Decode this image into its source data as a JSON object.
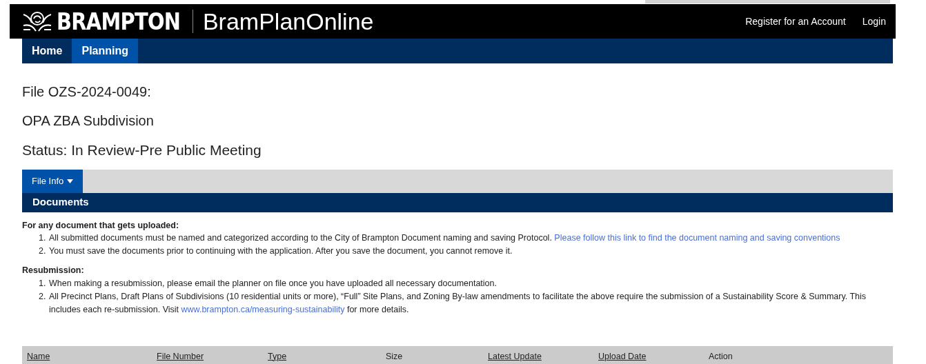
{
  "header": {
    "logo_text": "BRAMPTON",
    "site_title": "BramPlanOnline",
    "links": [
      "Register for an Account",
      "Login"
    ]
  },
  "nav": [
    {
      "label": "Home",
      "selected": false
    },
    {
      "label": "Planning",
      "selected": true
    }
  ],
  "file": {
    "title": "File OZS-2024-0049:",
    "type": "OPA ZBA Subdivision",
    "status": "Status: In Review-Pre Public Meeting"
  },
  "tabs": [
    {
      "label": "File Info",
      "selected": true
    }
  ],
  "section_title": "Documents",
  "notes": [
    {
      "heading": "For any document that gets uploaded:",
      "items": [
        {
          "number": "1.",
          "text": "All submitted documents must be named and categorized according to the City of Brampton Document naming and saving Protocol.",
          "link": "Please follow this link to find the document naming and saving conventions"
        },
        {
          "number": "2.",
          "text": "You must save the documents prior to continuing with the application. After you save the document, you cannot remove it."
        }
      ]
    },
    {
      "heading": "Resubmission:",
      "items": [
        {
          "number": "1.",
          "text": "When making a resubmission, please email the planner on file once you have uploaded all necessary documentation."
        },
        {
          "number": "2.",
          "text": "All Precinct Plans, Draft Plans of Subdivisions (10 residential units or more), “Full” Site Plans, and Zoning By-law amendments to facilitate the above require the submission of a Sustainability Score & Summary. This includes each re-submission. Visit",
          "link": "www.brampton.ca/measuring-sustainability",
          "after": "for more details."
        }
      ]
    }
  ],
  "table": {
    "columns": [
      {
        "label": "Name",
        "sortable": true
      },
      {
        "label": "File Number",
        "sortable": true
      },
      {
        "label": "Type",
        "sortable": true
      },
      {
        "label": "Size",
        "sortable": false
      },
      {
        "label": "Latest Update",
        "sortable": true
      },
      {
        "label": "Upload Date",
        "sortable": true
      },
      {
        "label": "Action",
        "sortable": false
      }
    ]
  }
}
